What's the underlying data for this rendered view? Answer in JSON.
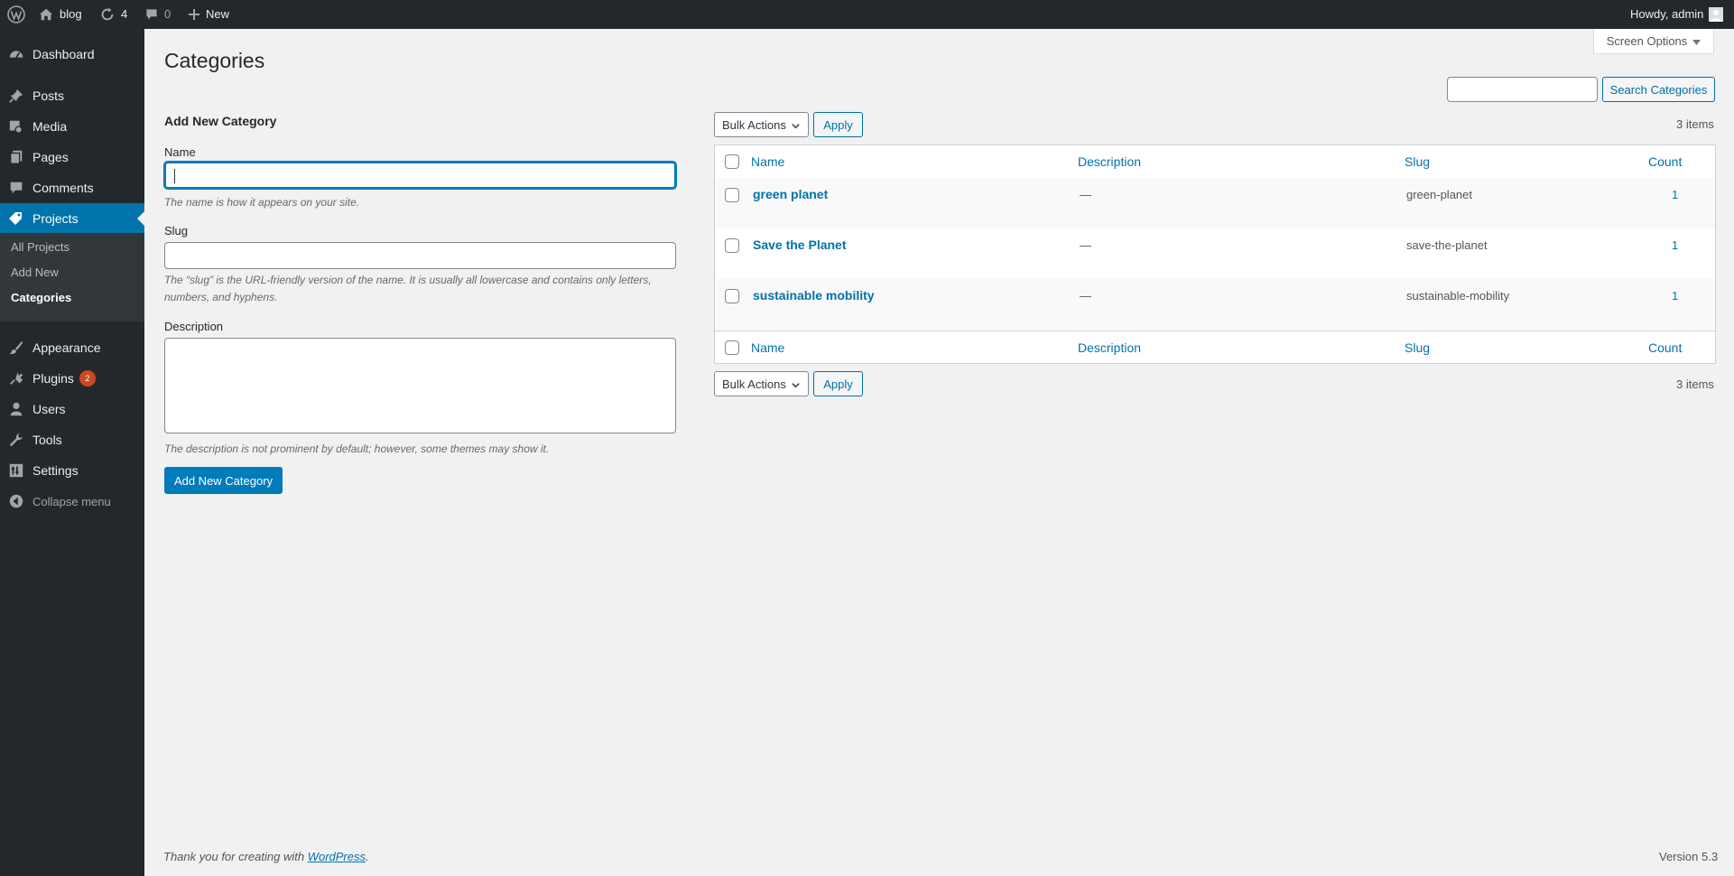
{
  "adminbar": {
    "site_name": "blog",
    "updates_count": "4",
    "comments_count": "0",
    "new_label": "New",
    "greeting": "Howdy, admin"
  },
  "sidebar": {
    "items": [
      {
        "label": "Dashboard",
        "icon": "dashboard-icon"
      },
      {
        "label": "Posts",
        "icon": "pin-icon"
      },
      {
        "label": "Media",
        "icon": "media-icon"
      },
      {
        "label": "Pages",
        "icon": "pages-icon"
      },
      {
        "label": "Comments",
        "icon": "comment-icon"
      },
      {
        "label": "Projects",
        "icon": "tag-icon"
      },
      {
        "label": "Appearance",
        "icon": "paintbrush-icon"
      },
      {
        "label": "Plugins",
        "icon": "plugin-icon",
        "badge": "2"
      },
      {
        "label": "Users",
        "icon": "user-icon"
      },
      {
        "label": "Tools",
        "icon": "wrench-icon"
      },
      {
        "label": "Settings",
        "icon": "settings-icon"
      }
    ],
    "submenu": [
      "All Projects",
      "Add New",
      "Categories"
    ],
    "collapse_label": "Collapse menu"
  },
  "screen_options": "Screen Options",
  "page_title": "Categories",
  "search": {
    "value": "",
    "button_label": "Search Categories"
  },
  "form": {
    "title": "Add New Category",
    "name_label": "Name",
    "name_value": "",
    "name_help": "The name is how it appears on your site.",
    "slug_label": "Slug",
    "slug_value": "",
    "slug_help": "The “slug” is the URL-friendly version of the name. It is usually all lowercase and contains only letters, numbers, and hyphens.",
    "description_label": "Description",
    "description_value": "",
    "description_help": "The description is not prominent by default; however, some themes may show it.",
    "submit_label": "Add New Category"
  },
  "bulk_actions": {
    "label": "Bulk Actions",
    "apply_label": "Apply"
  },
  "items_count": "3 items",
  "table": {
    "columns": [
      "Name",
      "Description",
      "Slug",
      "Count"
    ],
    "rows": [
      {
        "name": "green planet",
        "description": "—",
        "slug": "green-planet",
        "count": "1"
      },
      {
        "name": "Save the Planet",
        "description": "—",
        "slug": "save-the-planet",
        "count": "1"
      },
      {
        "name": "sustainable mobility",
        "description": "—",
        "slug": "sustainable-mobility",
        "count": "1"
      }
    ]
  },
  "footer": {
    "thanks_prefix": "Thank you for creating with ",
    "thanks_link": "WordPress",
    "thanks_suffix": ".",
    "version": "Version 5.3"
  },
  "colors": {
    "admin_bar": "#23282d",
    "accent": "#0073aa",
    "primary_button": "#007cba",
    "badge": "#ca4a1f",
    "background": "#f1f1f1"
  }
}
